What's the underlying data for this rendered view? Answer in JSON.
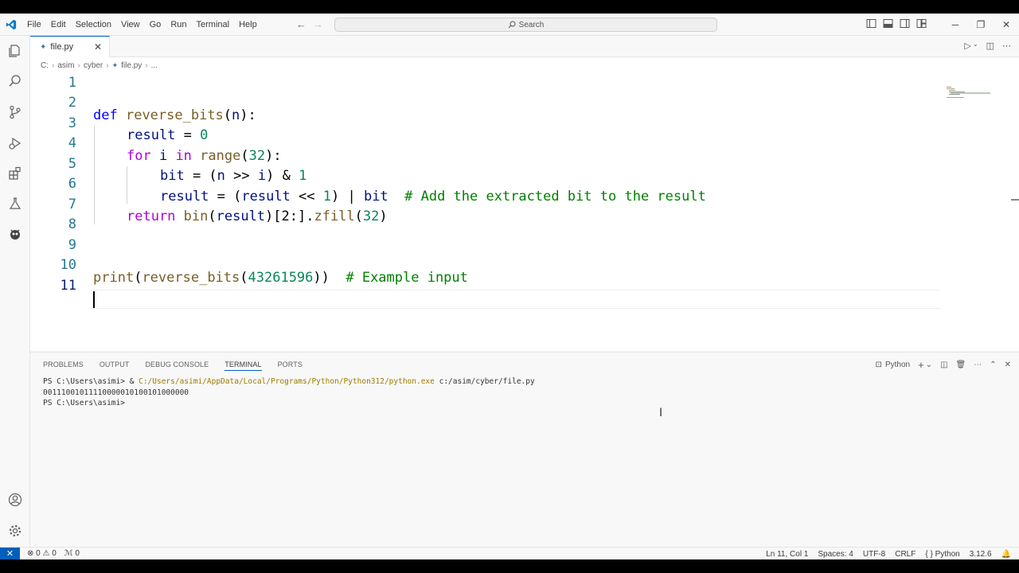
{
  "menu": [
    "File",
    "Edit",
    "Selection",
    "View",
    "Go",
    "Run",
    "Terminal",
    "Help"
  ],
  "search": {
    "label": "Search"
  },
  "tab": {
    "filename": "file.py"
  },
  "breadcrumb": [
    "C:",
    "asim",
    "cyber",
    "file.py",
    "..."
  ],
  "editor": {
    "line_numbers": [
      "1",
      "2",
      "3",
      "4",
      "5",
      "6",
      "7",
      "8",
      "9",
      "10",
      "11"
    ],
    "active_line": "11"
  },
  "code": {
    "l2": {
      "def": "def",
      "name": "reverse_bits",
      "open": "(",
      "param": "n",
      "close": "):"
    },
    "l3": {
      "var": "result",
      "eq": " = ",
      "num": "0"
    },
    "l4": {
      "for": "for",
      "i": " i ",
      "in": "in",
      "range": " range",
      "open": "(",
      "num": "32",
      "close": "):"
    },
    "l5": {
      "bit": "bit",
      "eq": " = (",
      "n": "n",
      "op": " >> ",
      "i": "i",
      "close": ") & ",
      "num": "1"
    },
    "l6": {
      "var": "result",
      "eq": " = (",
      "var2": "result",
      "op": " << ",
      "num": "1",
      "close": ") | ",
      "bit": "bit",
      "comment": "  # Add the extracted bit to the result"
    },
    "l7": {
      "ret": "return",
      "bin": " bin",
      "open": "(",
      "var": "result",
      "slice": ")[2:].",
      "zfill": "zfill",
      "open2": "(",
      "num": "32",
      "close": ")"
    },
    "l10": {
      "print": "print",
      "open": "(",
      "fn": "reverse_bits",
      "open2": "(",
      "num": "43261596",
      "close": "))",
      "comment": "  # Example input"
    }
  },
  "panel": {
    "tabs": [
      "PROBLEMS",
      "OUTPUT",
      "DEBUG CONSOLE",
      "TERMINAL",
      "PORTS"
    ],
    "active_tab": "TERMINAL",
    "shell_label": "Python",
    "terminal_lines": {
      "l1_prompt": "PS C:\\Users\\asimi> & ",
      "l1_exe": "C:/Users/asimi/AppData/Local/Programs/Python/Python312/python.exe",
      "l1_arg": " c:/asim/cyber/file.py",
      "l2": "00111001011110000010100101000000",
      "l3": "PS C:\\Users\\asimi>"
    }
  },
  "statusbar": {
    "errors": "0",
    "warnings": "0",
    "ports": "0",
    "position": "Ln 11, Col 1",
    "spaces": "Spaces: 4",
    "encoding": "UTF-8",
    "eol": "CRLF",
    "language": "Python",
    "version": "3.12.6"
  },
  "colors": {
    "accent": "#005fb8",
    "keyword": "#0000ff",
    "control": "#af00db",
    "function": "#795e26",
    "number": "#098658",
    "comment": "#008000"
  }
}
